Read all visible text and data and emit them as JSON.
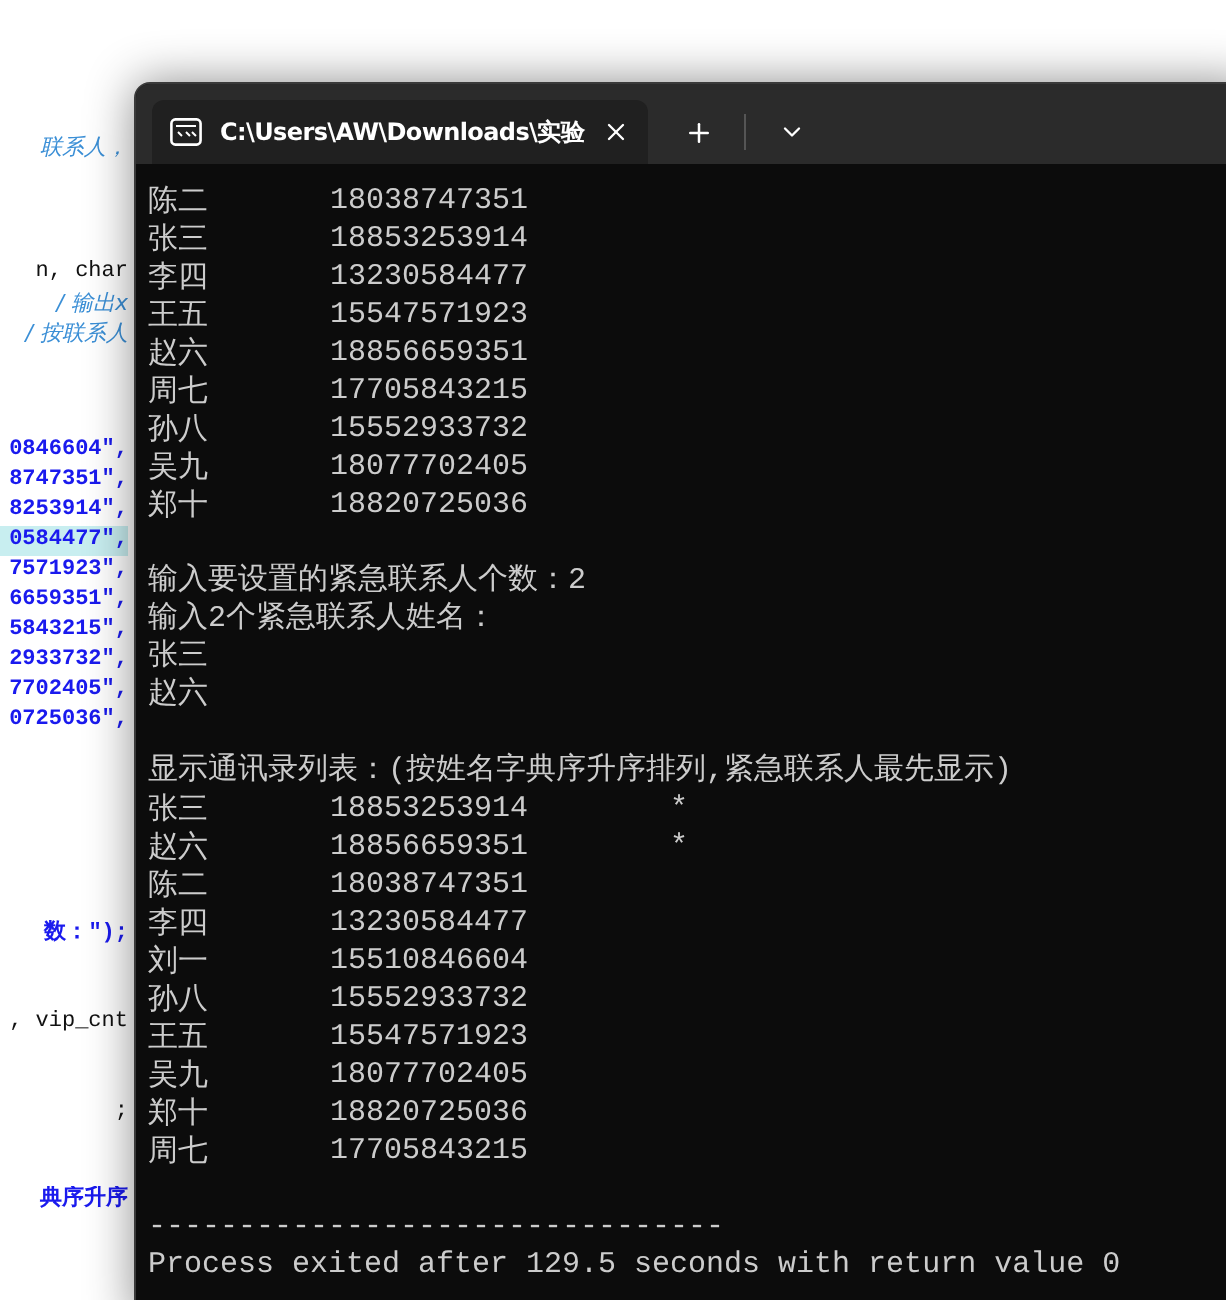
{
  "editor": {
    "lines": [
      {
        "kind": "comment",
        "text": "联系人，"
      },
      {
        "kind": "code",
        "text": "n, char"
      },
      {
        "kind": "comment",
        "text": "/ 输出x"
      },
      {
        "kind": "comment",
        "text": "/ 按联系人"
      },
      {
        "kind": "string",
        "text": "0846604\","
      },
      {
        "kind": "string",
        "text": "8747351\","
      },
      {
        "kind": "string",
        "text": "8253914\","
      },
      {
        "kind": "string",
        "text": "0584477\",",
        "highlighted": true
      },
      {
        "kind": "string",
        "text": "7571923\","
      },
      {
        "kind": "string",
        "text": "6659351\","
      },
      {
        "kind": "string",
        "text": "5843215\","
      },
      {
        "kind": "string",
        "text": "2933732\","
      },
      {
        "kind": "string",
        "text": "7702405\","
      },
      {
        "kind": "string",
        "text": "0725036\","
      },
      {
        "kind": "string",
        "text": "数：\");"
      },
      {
        "kind": "code",
        "text": ", vip_cnt"
      },
      {
        "kind": "code",
        "text": ";"
      },
      {
        "kind": "string",
        "text": "典序升序"
      }
    ]
  },
  "terminal": {
    "tab_title": "C:\\Users\\AW\\Downloads\\实验",
    "lines": [
      {
        "kind": "row",
        "name": "陈二",
        "phone": "18038747351"
      },
      {
        "kind": "row",
        "name": "张三",
        "phone": "18853253914"
      },
      {
        "kind": "row",
        "name": "李四",
        "phone": "13230584477"
      },
      {
        "kind": "row",
        "name": "王五",
        "phone": "15547571923"
      },
      {
        "kind": "row",
        "name": "赵六",
        "phone": "18856659351"
      },
      {
        "kind": "row",
        "name": "周七",
        "phone": "17705843215"
      },
      {
        "kind": "row",
        "name": "孙八",
        "phone": "15552933732"
      },
      {
        "kind": "row",
        "name": "吴九",
        "phone": "18077702405"
      },
      {
        "kind": "row",
        "name": "郑十",
        "phone": "18820725036"
      },
      {
        "kind": "blank"
      },
      {
        "kind": "text",
        "text": "输入要设置的紧急联系人个数：2"
      },
      {
        "kind": "text",
        "text": "输入2个紧急联系人姓名："
      },
      {
        "kind": "text",
        "text": "张三"
      },
      {
        "kind": "text",
        "text": "赵六"
      },
      {
        "kind": "blank"
      },
      {
        "kind": "text",
        "text": "显示通讯录列表：(按姓名字典序升序排列,紧急联系人最先显示)"
      },
      {
        "kind": "row",
        "name": "张三",
        "phone": "18853253914",
        "mark": "*"
      },
      {
        "kind": "row",
        "name": "赵六",
        "phone": "18856659351",
        "mark": "*"
      },
      {
        "kind": "row",
        "name": "陈二",
        "phone": "18038747351"
      },
      {
        "kind": "row",
        "name": "李四",
        "phone": "13230584477"
      },
      {
        "kind": "row",
        "name": "刘一",
        "phone": "15510846604"
      },
      {
        "kind": "row",
        "name": "孙八",
        "phone": "15552933732"
      },
      {
        "kind": "row",
        "name": "王五",
        "phone": "15547571923"
      },
      {
        "kind": "row",
        "name": "吴九",
        "phone": "18077702405"
      },
      {
        "kind": "row",
        "name": "郑十",
        "phone": "18820725036"
      },
      {
        "kind": "row",
        "name": "周七",
        "phone": "17705843215"
      },
      {
        "kind": "blank"
      },
      {
        "kind": "text",
        "text": "--------------------------------"
      },
      {
        "kind": "text",
        "text": "Process exited after 129.5 seconds with return value 0"
      }
    ]
  }
}
